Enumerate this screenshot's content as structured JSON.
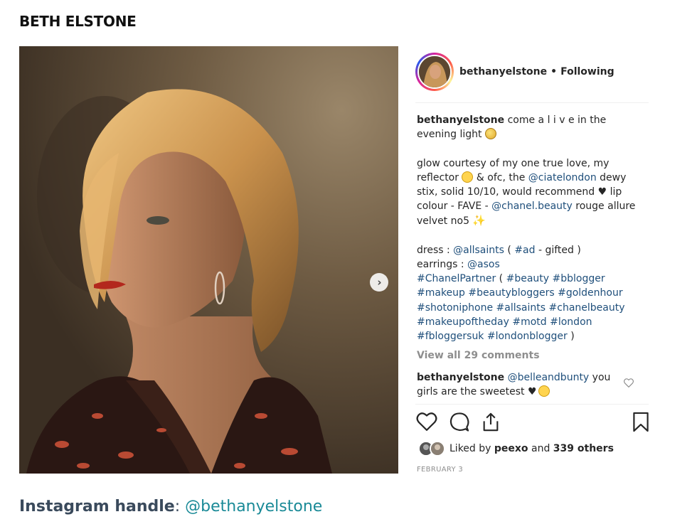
{
  "page_title": "BETH ELSTONE",
  "post": {
    "username": "bethanyelstone",
    "dot": "•",
    "following": "Following",
    "caption": {
      "line1_user": "bethanyelstone",
      "line1_text": " come a l i v e in the evening light ",
      "para2_a": "glow courtesy of my one true love, my reflector ",
      "para2_b": " & ofc, the ",
      "para2_link1": "@ciatelondon",
      "para2_c": " dewy stix, solid 10/10, would recommend ♥ lip colour - FAVE - ",
      "para2_link2": "@chanel.beauty",
      "para2_d": " rouge allure velvet no5 ",
      "dress_label": "dress : ",
      "dress_link": "@allsaints",
      "dress_paren_open": " ( ",
      "dress_ad": "#ad",
      "dress_rest": " - gifted )",
      "earrings_label": "earrings : ",
      "earrings_link": "@asos",
      "tag_chanelpartner": "#ChanelPartner",
      "paren_open": " ( ",
      "tag_beauty": "#beauty",
      "tag_bblogger": "#bblogger",
      "tag_makeup": "#makeup",
      "tag_beautybloggers": "#beautybloggers",
      "tag_goldenhour": "#goldenhour",
      "tag_shotoniphone": "#shotoniphone",
      "tag_allsaints": "#allsaints",
      "tag_chanelbeauty": "#chanelbeauty",
      "tag_makeupoftheday": "#makeupoftheday",
      "tag_motd": "#motd",
      "tag_london": "#london",
      "tag_fbloggersuk": "#fbloggersuk",
      "tag_londonblogger": "#londonblogger",
      "paren_close": " )"
    },
    "view_comments": "View all 29 comments",
    "comment": {
      "user": "bethanyelstone",
      "mention": "@belleandbunty",
      "text": " you girls are the sweetest ♥"
    },
    "likes": {
      "prefix": "Liked by ",
      "user": "peexo",
      "middle": " and ",
      "count": "339 others"
    },
    "date": "FEBRUARY 3"
  },
  "footer": {
    "label": "Instagram handle",
    "colon": ": ",
    "handle": "@bethanyelstone"
  },
  "icons": [
    "next-arrow-icon",
    "heart-icon",
    "comment-icon",
    "share-icon",
    "bookmark-icon",
    "small-heart-icon"
  ],
  "colors": {
    "link": "#1f4f7b",
    "muted": "#8e8e8e",
    "footer_link": "#1a8a97"
  }
}
